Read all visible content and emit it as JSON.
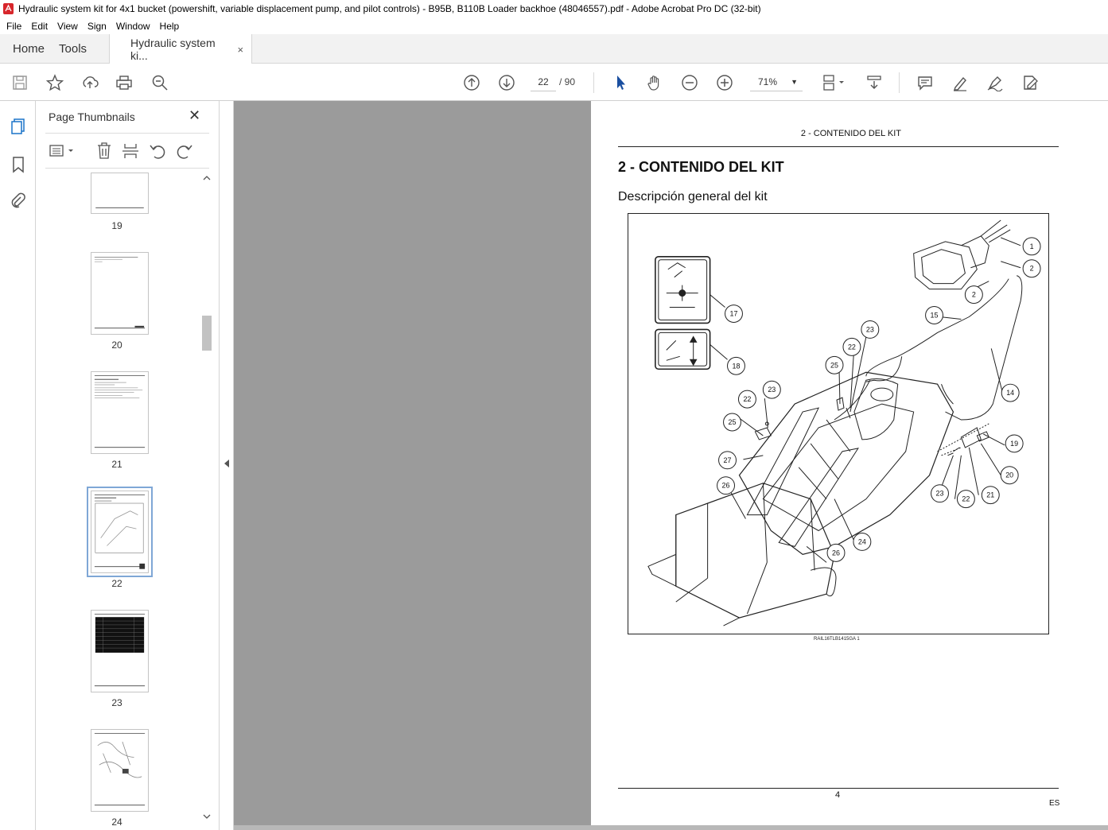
{
  "window": {
    "title": "Hydraulic system kit for 4x1 bucket (powershift, variable displacement pump, and pilot controls) - B95B, B110B Loader backhoe (48046557).pdf - Adobe Acrobat Pro DC (32-bit)"
  },
  "menu": [
    "File",
    "Edit",
    "View",
    "Sign",
    "Window",
    "Help"
  ],
  "tabs": {
    "home": "Home",
    "tools": "Tools",
    "document": "Hydraulic system ki...",
    "close": "×"
  },
  "toolbar": {
    "current_page": "22",
    "total_pages": "/ 90",
    "zoom": "71%",
    "zoom_caret": "▼"
  },
  "panel": {
    "title": "Page Thumbnails",
    "close": "✕",
    "thumbnails": [
      {
        "label": "19"
      },
      {
        "label": "20"
      },
      {
        "label": "21"
      },
      {
        "label": "22",
        "selected": true
      },
      {
        "label": "23"
      },
      {
        "label": "24"
      }
    ]
  },
  "document_page": {
    "header": "2 - CONTENIDO DEL KIT",
    "heading": "2 - CONTENIDO DEL KIT",
    "subheading": "Descripción general del kit",
    "figure_code": "RAIL16TLB1415GA    1",
    "page_number": "4",
    "language": "ES",
    "callouts": [
      "1",
      "2",
      "2",
      "15",
      "14",
      "17",
      "18",
      "23",
      "22",
      "25",
      "22",
      "23",
      "25",
      "27",
      "26",
      "19",
      "20",
      "21",
      "22",
      "23",
      "24",
      "26"
    ]
  }
}
